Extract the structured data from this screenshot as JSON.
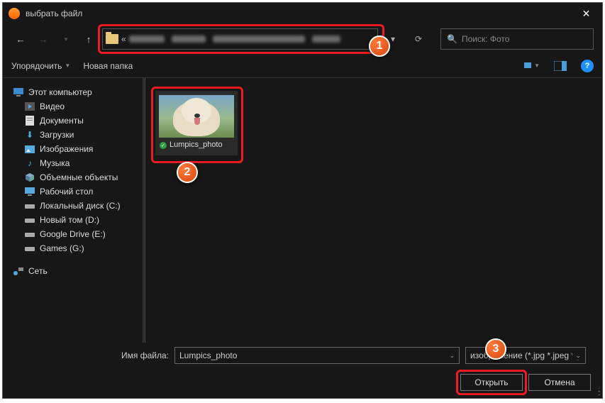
{
  "title": "выбрать файл",
  "search_placeholder": "Поиск: Фото",
  "toolbar": {
    "organize": "Упорядочить",
    "newfolder": "Новая папка"
  },
  "sidebar": {
    "root": "Этот компьютер",
    "items": [
      "Видео",
      "Документы",
      "Загрузки",
      "Изображения",
      "Музыка",
      "Объемные объекты",
      "Рабочий стол",
      "Локальный диск (C:)",
      "Новый том (D:)",
      "Google Drive (E:)",
      "Games (G:)"
    ],
    "network": "Сеть"
  },
  "file": {
    "name": "Lumpics_photo",
    "display": "Lumpics_photo"
  },
  "bottom": {
    "filename_label": "Имя файла:",
    "filename_value": "Lumpics_photo",
    "filter": "изображение (*.jpg *.jpeg *.png)",
    "open": "Открыть",
    "cancel": "Отмена"
  },
  "callouts": {
    "c1": "1",
    "c2": "2",
    "c3": "3"
  }
}
